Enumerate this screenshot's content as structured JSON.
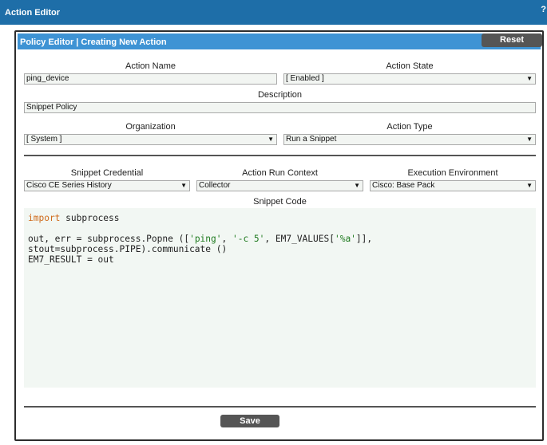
{
  "window": {
    "title": "Action Editor",
    "close_glyph": "?"
  },
  "panel": {
    "title": "Policy Editor | Creating New Action",
    "reset_label": "Reset"
  },
  "form": {
    "action_name": {
      "label": "Action Name",
      "value": "ping_device"
    },
    "action_state": {
      "label": "Action State",
      "value": "[ Enabled ]"
    },
    "description": {
      "label": "Description",
      "value": "Snippet Policy"
    },
    "organization": {
      "label": "Organization",
      "value": "[ System ]"
    },
    "action_type": {
      "label": "Action Type",
      "value": "Run a Snippet"
    },
    "snippet_credential": {
      "label": "Snippet Credential",
      "value": "Cisco CE Series History"
    },
    "action_run_context": {
      "label": "Action Run Context",
      "value": "Collector"
    },
    "execution_environment": {
      "label": "Execution Environment",
      "value": "Cisco: Base Pack"
    },
    "snippet_code": {
      "label": "Snippet Code",
      "line1": {
        "keyword": "import",
        "rest": " subprocess"
      },
      "line3": {
        "pre": "out, err = subprocess.Popne ([",
        "s1": "'ping'",
        "sep1": ", ",
        "s2": "'-c 5'",
        "sep2": ", EM7_VALUES[",
        "s3": "'%a'",
        "post": "]],"
      },
      "line4": "stout=subprocess.PIPE).communicate ()",
      "line5": "EM7_RESULT = out"
    }
  },
  "footer": {
    "save_label": "Save"
  }
}
